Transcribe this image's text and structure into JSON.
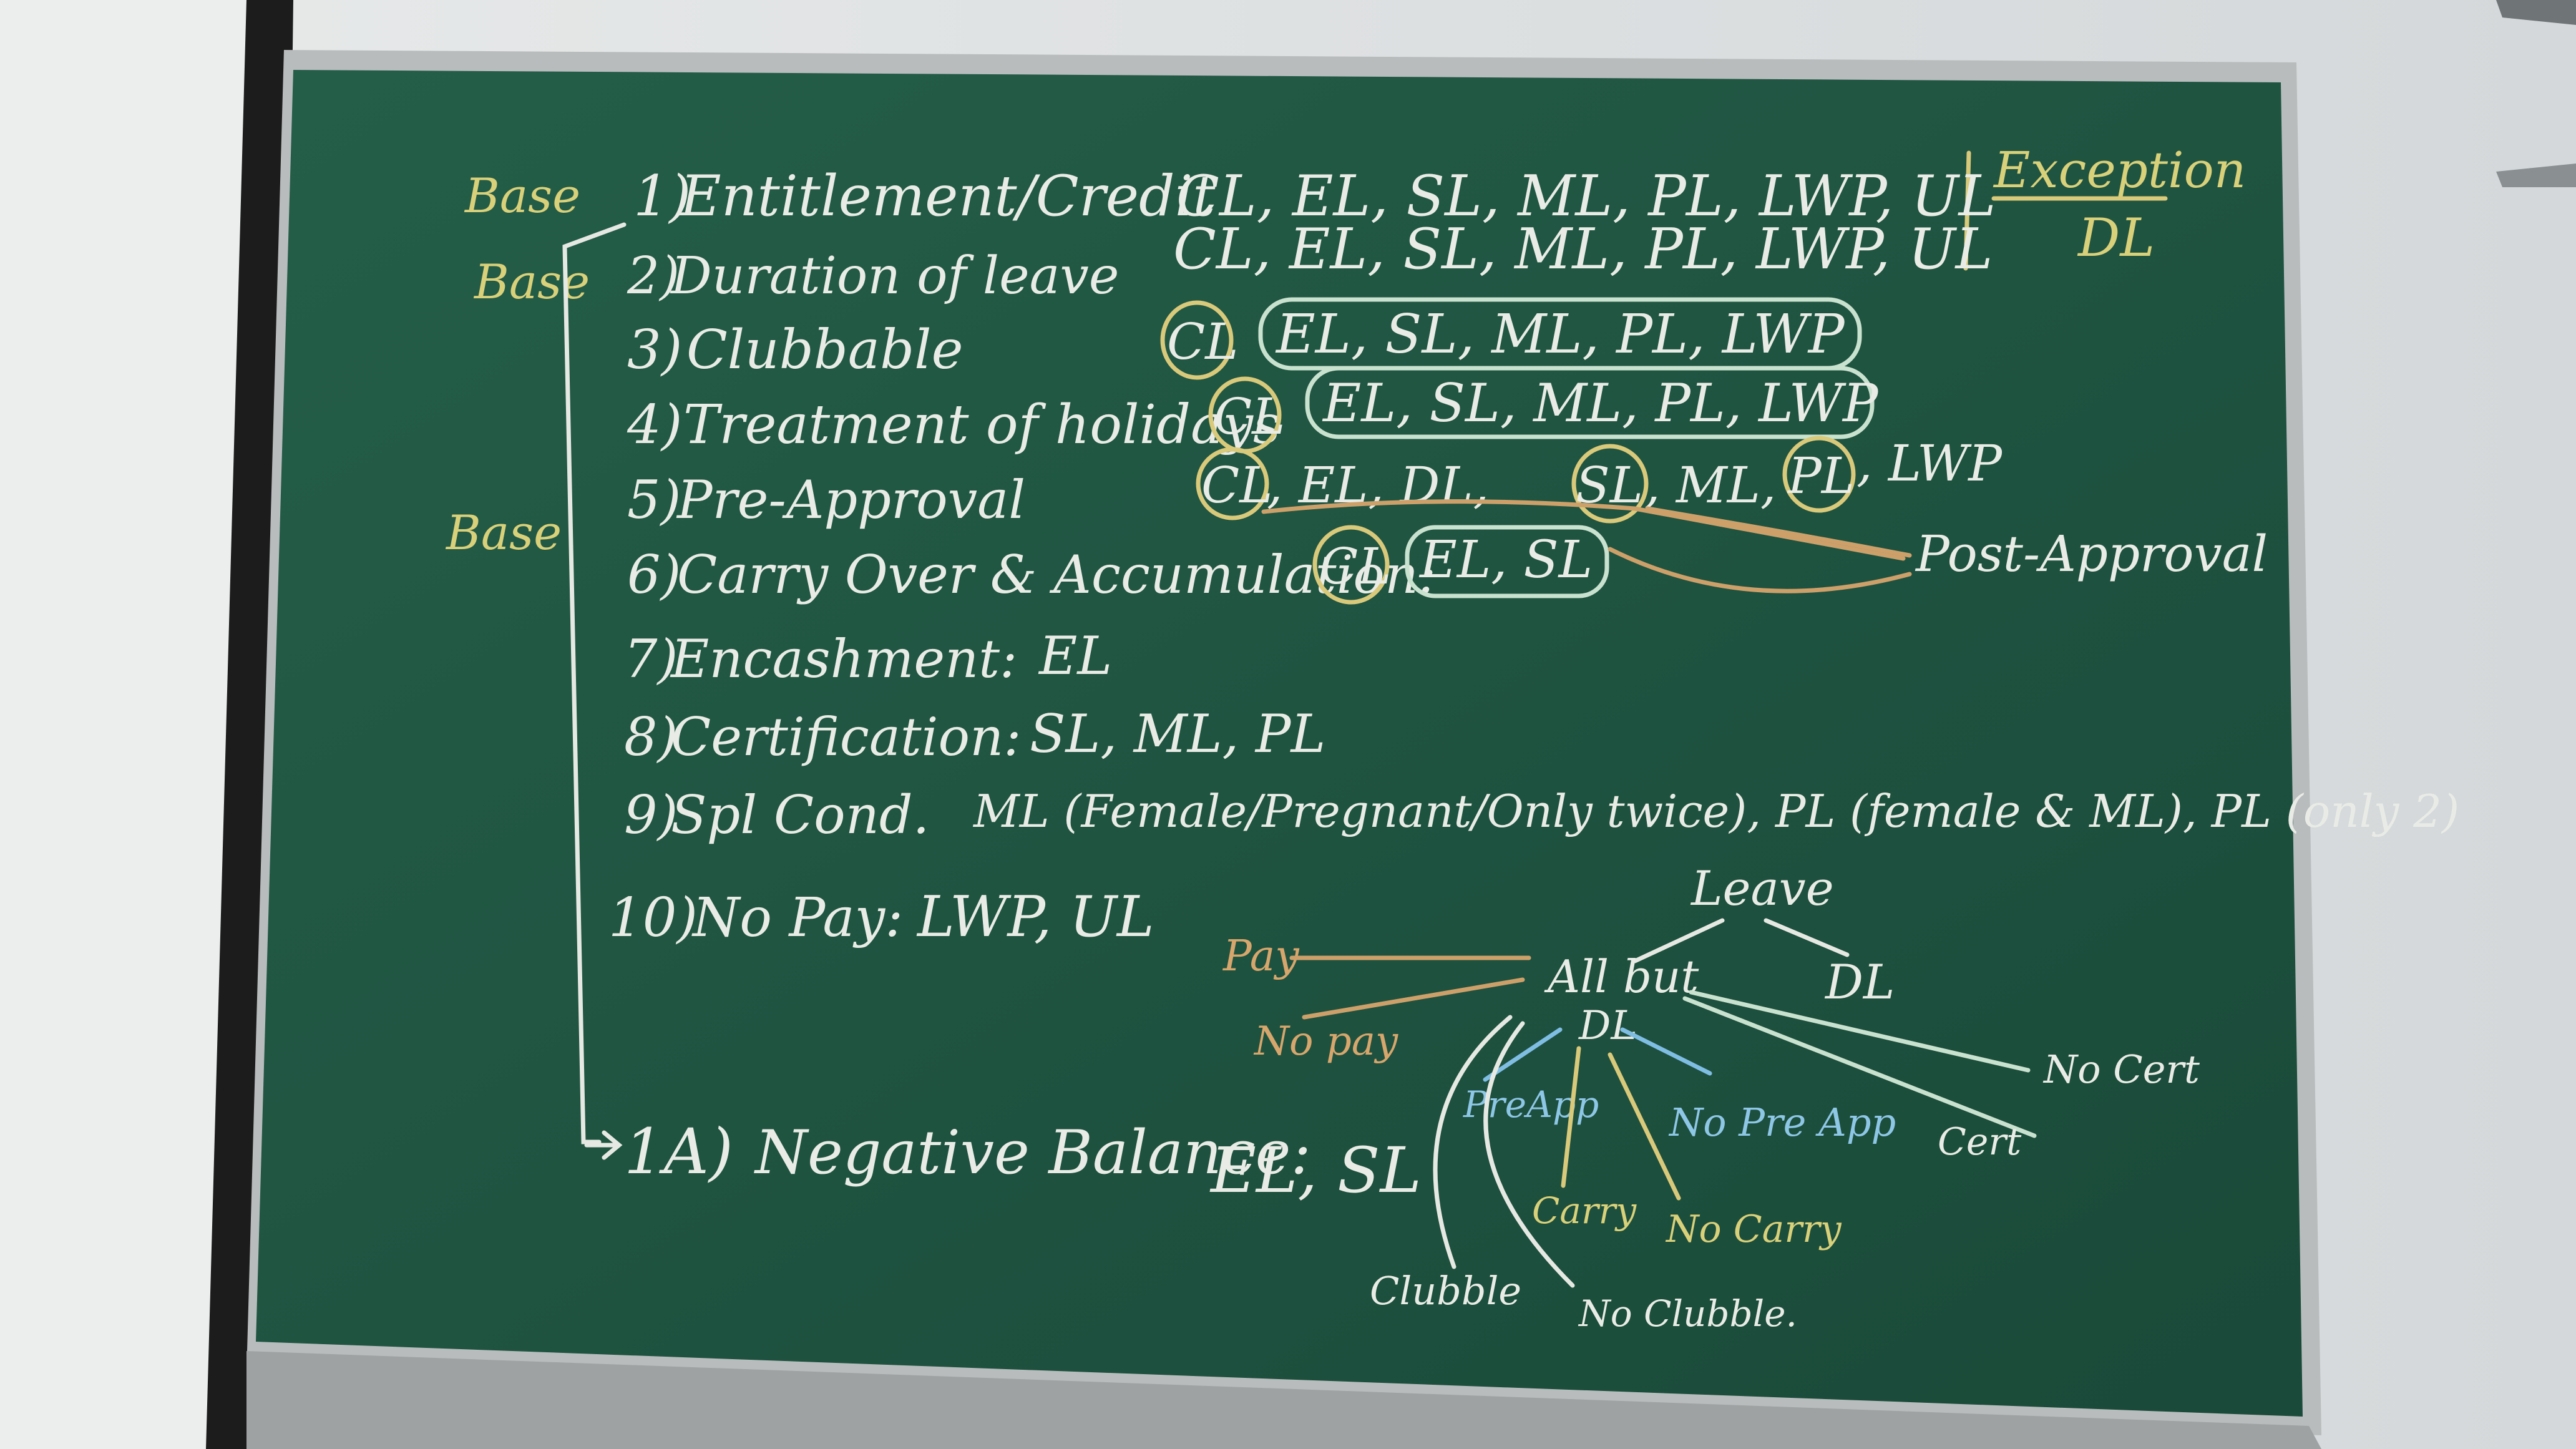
{
  "board": {
    "tags": {
      "base1": "Base",
      "base2": "Base",
      "base3": "Base"
    },
    "exception": {
      "title": "Exception",
      "value": "DL"
    },
    "rows": [
      {
        "num": "1)",
        "label": "Entitlement/Credit",
        "leaves": "CL, EL, SL, ML, PL, LWP, UL"
      },
      {
        "num": "2)",
        "label": "Duration of leave",
        "leaves": "CL, EL, SL, ML, PL, LWP, UL"
      },
      {
        "num": "3)",
        "label": "Clubbable",
        "leave_circled": "CL",
        "leaves_group": "EL, SL, ML, PL, LWP"
      },
      {
        "num": "4)",
        "label": "Treatment of holidays",
        "leave_circled": "CL",
        "leaves_group": "EL, SL, ML, PL, LWP"
      },
      {
        "num": "5)",
        "label": "Pre-Approval",
        "leave_circled": "CL",
        "middle": ", EL, DL,",
        "circ2": "SL",
        "mid2": ", ML,",
        "circ3": "PL",
        "tail": ", LWP"
      },
      {
        "num": "6)",
        "label": "Carry Over & Accumulation:",
        "leave_circled": "CL",
        "leaves_group": "EL, SL"
      },
      {
        "num": "7)",
        "label": "Encashment:",
        "leaves": "EL"
      },
      {
        "num": "8)",
        "label": "Certification:",
        "leaves": "SL, ML, PL"
      },
      {
        "num": "9)",
        "label": "Spl Cond.",
        "leaves": "ML (Female/Pregnant/Only twice), PL (female & ML), PL (only 2)"
      },
      {
        "num": "10)",
        "label": "No Pay:",
        "leaves": "LWP, UL"
      }
    ],
    "post_approval": "Post-Approval",
    "negative_balance": {
      "num": "1A)",
      "label": "Negative Balance:",
      "leaves": "EL, SL"
    },
    "tree": {
      "root": "Leave",
      "all_but": "All but",
      "all_but_dl": "DL",
      "dl": "DL",
      "pay": "Pay",
      "no_pay": "No pay",
      "pre_app": "PreApp",
      "no_pre_app": "No Pre App",
      "carry": "Carry",
      "no_carry": "No Carry",
      "clubble": "Clubble",
      "no_clubble": "No Clubble.",
      "cert": "Cert",
      "no_cert": "No Cert"
    }
  },
  "colors": {
    "board": "#1e5240",
    "chalk_white": "#e9ece6",
    "chalk_yellow": "#d9d07a",
    "chalk_orange": "#d7a66c",
    "chalk_blue": "#8ec6e6",
    "frame": "#b9bcbd"
  }
}
